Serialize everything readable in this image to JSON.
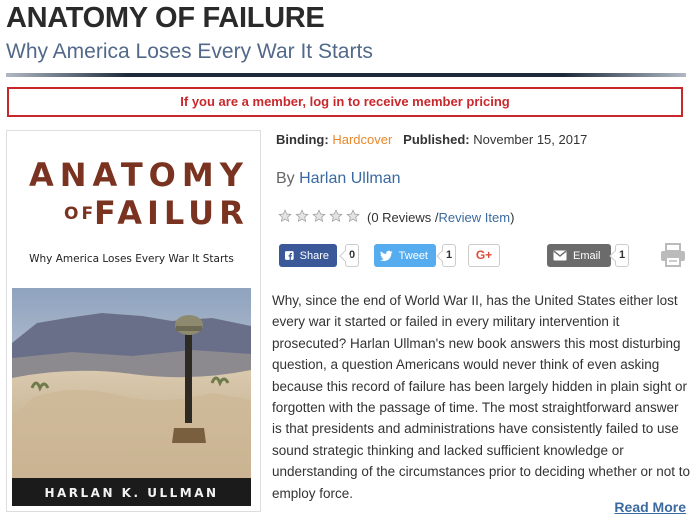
{
  "header": {
    "title": "ANATOMY OF FAILURE",
    "subtitle": "Why America Loses Every War It Starts"
  },
  "member_notice": "If you are a member, log in to receive member pricing",
  "cover": {
    "title_line1": "ANATOMY",
    "title_of": "OF",
    "title_line2": "FAILURE",
    "subtitle": "Why America Loses Every War It Starts",
    "author": "HARLAN K. ULLMAN"
  },
  "details": {
    "binding_label": "Binding:",
    "binding_value": "Hardcover",
    "published_label": "Published:",
    "published_value": "November 15, 2017",
    "by_label": "By",
    "author": "Harlan Ullman"
  },
  "rating": {
    "stars": 0,
    "max_stars": 5,
    "reviews_text": "(0 Reviews / ",
    "review_link": "Review Item",
    "close": ")"
  },
  "share": {
    "facebook_label": "Share",
    "facebook_count": "0",
    "twitter_label": "Tweet",
    "twitter_count": "1",
    "gplus_label": "G+",
    "email_label": "Email",
    "email_count": "1"
  },
  "description": "Why, since the end of World War II, has the United States either lost every war it started or failed in every military intervention it prosecuted? Harlan Ullman's new book answers this most disturbing question, a question Americans would never think of even asking because this record of failure has been largely hidden in plain sight or forgotten with the passage of time. The most straightforward answer is that presidents and administrations have consistently failed to use sound strategic thinking and lacked sufficient knowledge or understanding of the circumstances prior to deciding whether or not to employ force.",
  "read_more": "Read More",
  "colors": {
    "accent_red": "#c8282c",
    "link_blue": "#3a6aa0",
    "binding_orange": "#e8882a",
    "facebook": "#3b5998",
    "twitter": "#55acee",
    "email": "#6b6b6b"
  }
}
